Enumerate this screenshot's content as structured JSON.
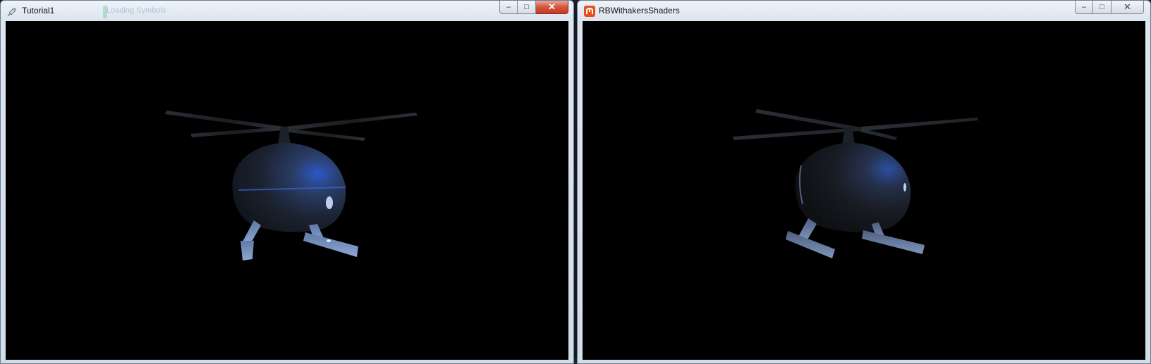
{
  "windows": {
    "left": {
      "title": "Tutorial1",
      "background_title_text": "Loading Symbols",
      "icon": "pushpin-icon",
      "controls": {
        "minimize": "–",
        "maximize": "□",
        "close": "✕"
      },
      "viewport_content": "helicopter-model"
    },
    "right": {
      "title": "RBWithakersShaders",
      "icon": "monogame-icon",
      "controls": {
        "minimize": "–",
        "maximize": "□",
        "close": "✕"
      },
      "viewport_content": "helicopter-model"
    }
  },
  "colors": {
    "viewport_background": "#000000",
    "accent_blue": "#2a5bd7",
    "close_red": "#c43a22",
    "app_icon_orange": "#e8501a"
  }
}
